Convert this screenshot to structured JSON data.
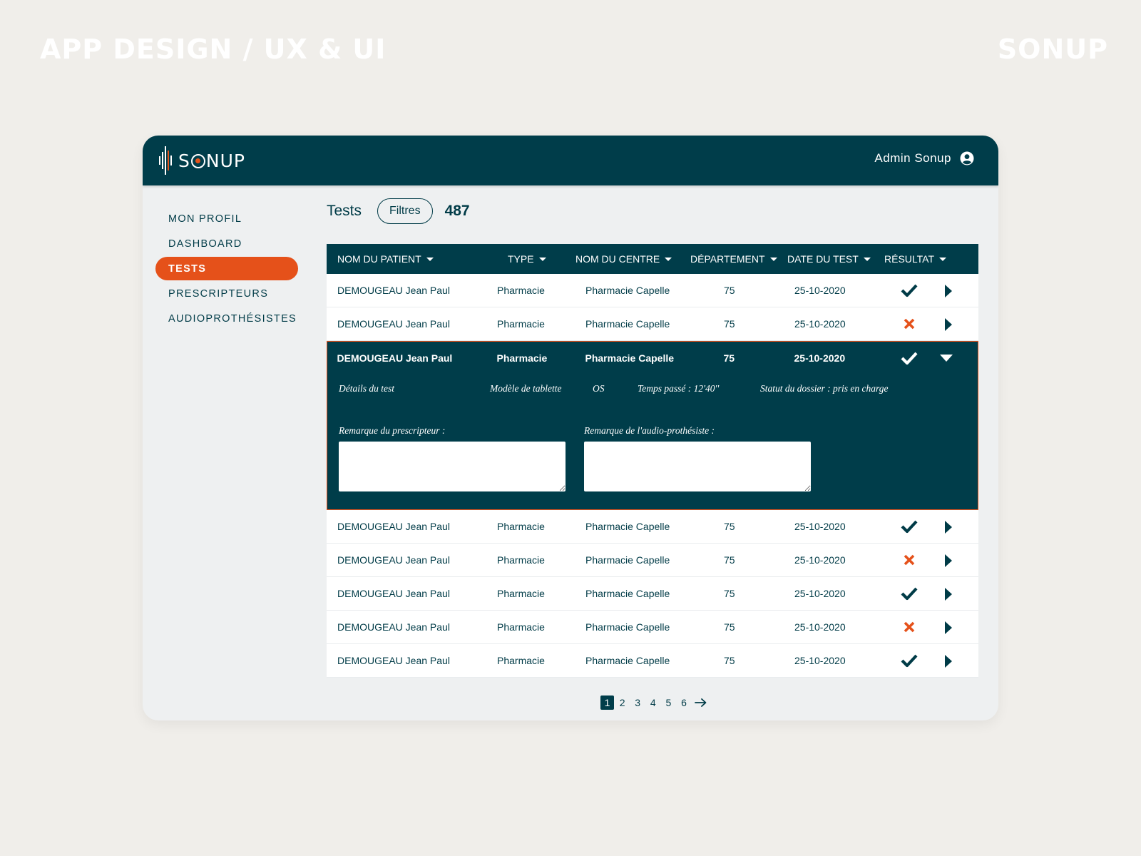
{
  "captions": {
    "left": "APP DESIGN / UX & UI",
    "right": "SONUP"
  },
  "header": {
    "logo_text_pre": "S",
    "logo_text_post": "NUP",
    "user_name": "Admin Sonup"
  },
  "sidebar": {
    "items": [
      {
        "label": "MON PROFIL",
        "active": false
      },
      {
        "label": "DASHBOARD",
        "active": false
      },
      {
        "label": "TESTS",
        "active": true
      },
      {
        "label": "PRESCRIPTEURS",
        "active": false
      },
      {
        "label": "AUDIOPROTHÉSISTES",
        "active": false
      }
    ]
  },
  "page": {
    "title": "Tests",
    "filter_label": "Filtres",
    "count": "487"
  },
  "table": {
    "columns": [
      "NOM DU PATIENT",
      "TYPE",
      "NOM DU CENTRE",
      "DÉPARTEMENT",
      "DATE DU TEST",
      "RÉSULTAT"
    ],
    "rows": [
      {
        "patient": "DEMOUGEAU Jean Paul",
        "type": "Pharmacie",
        "centre": "Pharmacie Capelle",
        "dept": "75",
        "date": "25-10-2020",
        "result": "check-icon",
        "arrow": "chevron-right-icon"
      },
      {
        "patient": "DEMOUGEAU Jean Paul",
        "type": "Pharmacie",
        "centre": "Pharmacie Capelle",
        "dept": "75",
        "date": "25-10-2020",
        "result": "cross-icon",
        "arrow": "chevron-right-icon"
      },
      {
        "patient": "DEMOUGEAU Jean Paul",
        "type": "Pharmacie",
        "centre": "Pharmacie Capelle",
        "dept": "75",
        "date": "25-10-2020",
        "result": "check-icon",
        "arrow": "chevron-down-icon"
      },
      {
        "patient": "DEMOUGEAU Jean Paul",
        "type": "Pharmacie",
        "centre": "Pharmacie Capelle",
        "dept": "75",
        "date": "25-10-2020",
        "result": "check-icon",
        "arrow": "chevron-right-icon"
      },
      {
        "patient": "DEMOUGEAU Jean Paul",
        "type": "Pharmacie",
        "centre": "Pharmacie Capelle",
        "dept": "75",
        "date": "25-10-2020",
        "result": "cross-icon",
        "arrow": "chevron-right-icon"
      },
      {
        "patient": "DEMOUGEAU Jean Paul",
        "type": "Pharmacie",
        "centre": "Pharmacie Capelle",
        "dept": "75",
        "date": "25-10-2020",
        "result": "check-icon",
        "arrow": "chevron-right-icon"
      },
      {
        "patient": "DEMOUGEAU Jean Paul",
        "type": "Pharmacie",
        "centre": "Pharmacie Capelle",
        "dept": "75",
        "date": "25-10-2020",
        "result": "cross-icon",
        "arrow": "chevron-right-icon"
      },
      {
        "patient": "DEMOUGEAU Jean Paul",
        "type": "Pharmacie",
        "centre": "Pharmacie Capelle",
        "dept": "75",
        "date": "25-10-2020",
        "result": "check-icon",
        "arrow": "chevron-right-icon"
      }
    ],
    "expanded_row_index": 2,
    "details": {
      "label": "Détails du test",
      "tablet": "Modèle de tablette",
      "os": "OS",
      "time": "Temps passé : 12'40''",
      "status": "Statut du dossier : pris en charge",
      "remark_prescriber_label": "Remarque du prescripteur :",
      "remark_prescriber_value": "",
      "remark_audio_label": "Remarque de l'audio-prothésiste :",
      "remark_audio_value": ""
    }
  },
  "pagination": {
    "pages": [
      "1",
      "2",
      "3",
      "4",
      "5",
      "6"
    ],
    "current": "1",
    "next_icon": "arrow-right-icon"
  },
  "colors": {
    "primary": "#003D4A",
    "accent": "#E5511A",
    "background": "#F0EEEA",
    "panel": "#EEF0F1"
  }
}
